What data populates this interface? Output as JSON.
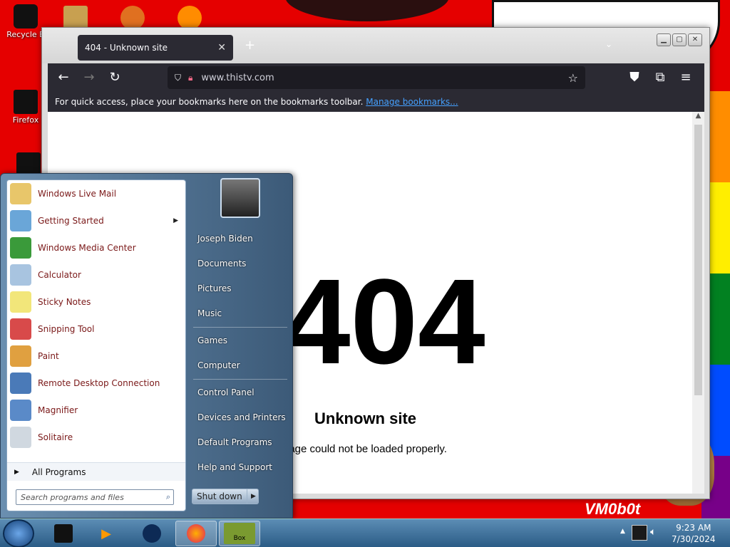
{
  "desktop": {
    "icons": [
      {
        "label": "Recycle B",
        "icon": "recycle-bin-icon"
      },
      {
        "label": "Firefox",
        "icon": "firefox-icon"
      }
    ],
    "watermark": "VM0b0t"
  },
  "browser": {
    "tab_title": "404 - Unknown site",
    "new_tab": "+",
    "url": "www.thistv.com",
    "bookmarks_message": "For quick access, place your bookmarks here on the bookmarks toolbar.",
    "bookmarks_link": "Manage bookmarks...",
    "page": {
      "code": "404",
      "title": "Unknown site",
      "description": "page could not be loaded properly."
    }
  },
  "start_menu": {
    "programs": [
      {
        "label": "Windows Live Mail",
        "icon": "mail-icon",
        "color": "#e8c66a"
      },
      {
        "label": "Getting Started",
        "icon": "getting-started-icon",
        "color": "#6aa6d8",
        "submenu": true
      },
      {
        "label": "Windows Media Center",
        "icon": "media-center-icon",
        "color": "#3a9a3a"
      },
      {
        "label": "Calculator",
        "icon": "calculator-icon",
        "color": "#a8c4e0"
      },
      {
        "label": "Sticky Notes",
        "icon": "sticky-notes-icon",
        "color": "#f2e67a"
      },
      {
        "label": "Snipping Tool",
        "icon": "scissors-icon",
        "color": "#d84a4a"
      },
      {
        "label": "Paint",
        "icon": "paint-icon",
        "color": "#e0a040"
      },
      {
        "label": "Remote Desktop Connection",
        "icon": "remote-desktop-icon",
        "color": "#4a7ab8"
      },
      {
        "label": "Magnifier",
        "icon": "magnifier-icon",
        "color": "#5a8ac8"
      },
      {
        "label": "Solitaire",
        "icon": "solitaire-icon",
        "color": "#d0d8e0"
      }
    ],
    "all_programs": "All Programs",
    "search_placeholder": "Search programs and files",
    "right": {
      "user": "Joseph Biden",
      "documents": "Documents",
      "pictures": "Pictures",
      "music": "Music",
      "games": "Games",
      "computer": "Computer",
      "control_panel": "Control Panel",
      "devices": "Devices and Printers",
      "default_programs": "Default Programs",
      "help": "Help and Support"
    },
    "shutdown": "Shut down"
  },
  "taskbar": {
    "time": "9:23 AM",
    "date": "7/30/2024",
    "box_label": "Box"
  }
}
